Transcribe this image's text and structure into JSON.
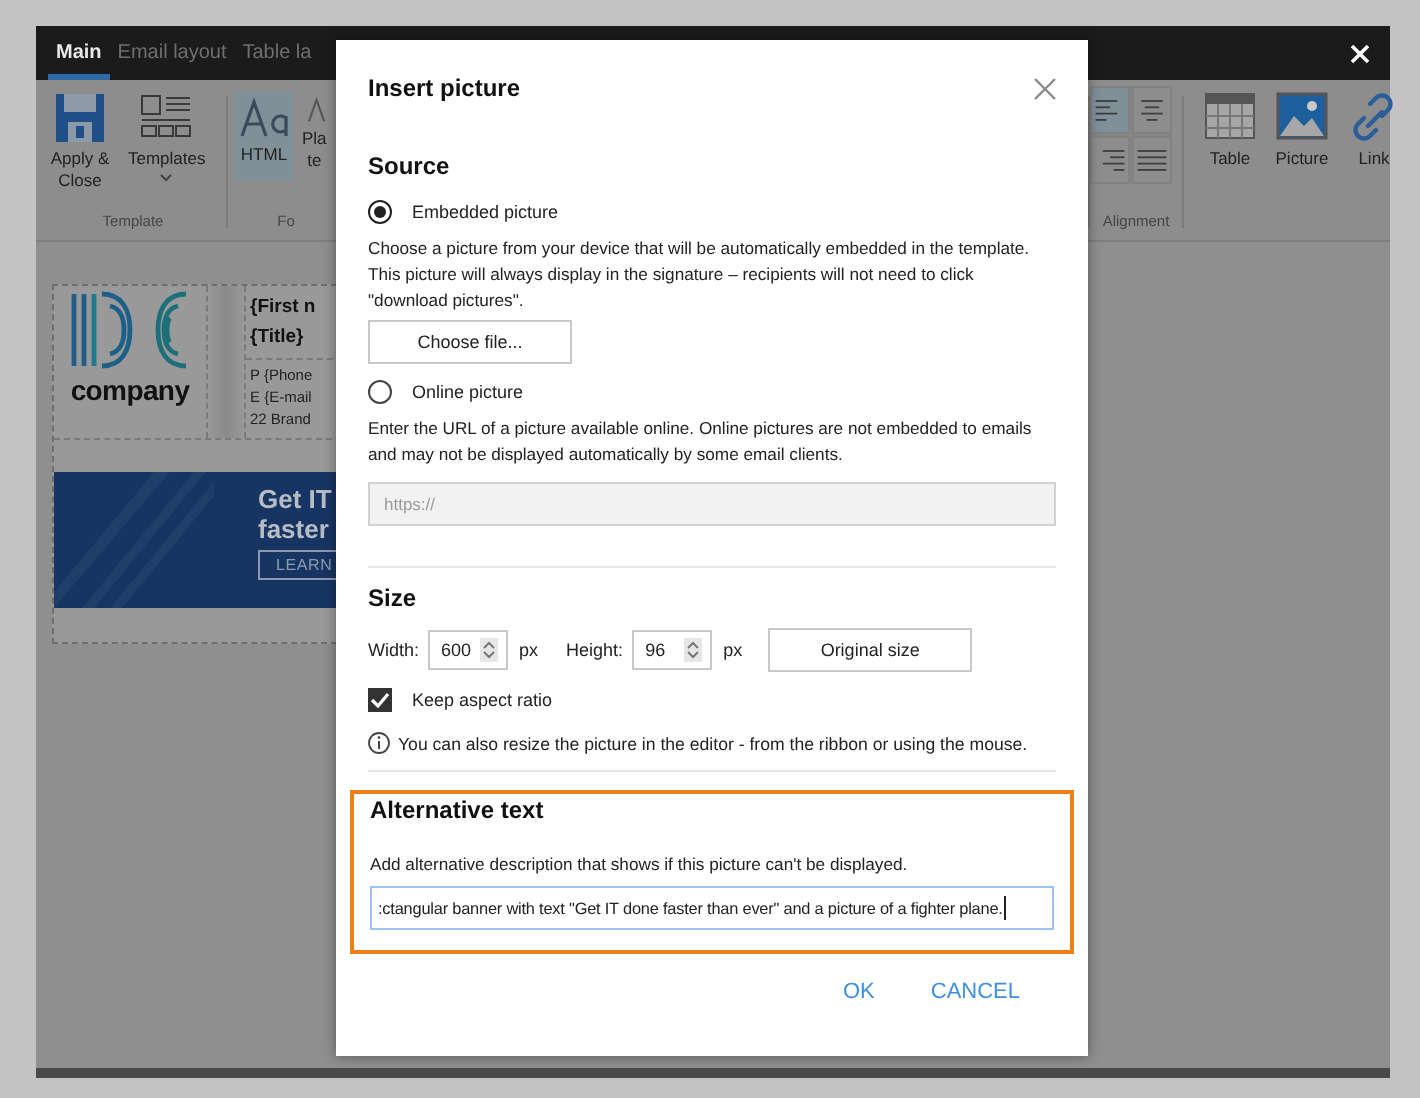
{
  "window": {
    "tabs": [
      {
        "label": "Main",
        "selected": true
      },
      {
        "label": "Email layout",
        "selected": false
      },
      {
        "label": "Table la",
        "selected": false
      }
    ]
  },
  "ribbon": {
    "template_group": {
      "label": "Template",
      "buttons": [
        {
          "kind": "save",
          "label": "Apply & Close"
        },
        {
          "kind": "templates",
          "label": "Templates"
        }
      ]
    },
    "format_group": {
      "label": "Fo",
      "buttons": [
        {
          "kind": "html",
          "lines": [
            "HTML"
          ],
          "selected": true
        },
        {
          "kind": "plain",
          "lines": [
            "Pla",
            "te"
          ],
          "selected": false
        }
      ]
    },
    "alignment_group": {
      "label": "Alignment",
      "options": [
        {
          "kind": "left",
          "selected": true
        },
        {
          "kind": "center",
          "selected": false
        },
        {
          "kind": "right",
          "selected": false
        },
        {
          "kind": "justify",
          "selected": false
        }
      ]
    },
    "insert_group": {
      "buttons": [
        {
          "kind": "table",
          "label": "Table"
        },
        {
          "kind": "picture",
          "label": "Picture"
        },
        {
          "kind": "link",
          "label": "Link"
        }
      ]
    }
  },
  "signature": {
    "logo_text": "company",
    "name_lines": [
      "{First n",
      "{Title}"
    ],
    "contact_lines": [
      "P {Phone",
      "E {E-mail",
      "22 Brand"
    ],
    "banner": {
      "lines": [
        "Get IT",
        "faster"
      ],
      "button": "LEARN"
    }
  },
  "dialog": {
    "title": "Insert picture",
    "source": {
      "heading": "Source",
      "options": [
        {
          "kind": "file",
          "label": "Embedded picture",
          "selected": true,
          "description": "Choose a picture from your device that will be automatically embedded in the template. This picture will always display in the signature – recipients will not need to click \"download pictures\".",
          "button": "Choose file..."
        },
        {
          "kind": "url",
          "label": "Online picture",
          "selected": false,
          "description": "Enter the URL of a picture available online. Online pictures are not embedded to emails and may not be displayed automatically by some email clients.",
          "field": {
            "placeholder": "https://",
            "disabled": true
          }
        }
      ]
    },
    "size": {
      "heading": "Size",
      "width": {
        "label": "Width:",
        "value": "600",
        "unit": "px"
      },
      "height": {
        "label": "Height:",
        "value": "96",
        "unit": "px"
      },
      "original_button": "Original size",
      "keep_aspect": {
        "label": "Keep aspect ratio",
        "checked": true
      },
      "info": "You can also resize the picture in the editor - from the ribbon or using the mouse."
    },
    "alt_text": {
      "heading": "Alternative text",
      "focused": true,
      "description": "Add alternative description that shows if this picture can't be displayed.",
      "value": ":ctangular banner with text \"Get IT done faster than ever\" and a picture of a fighter plane."
    },
    "buttons": [
      "OK",
      "CANCEL"
    ]
  }
}
